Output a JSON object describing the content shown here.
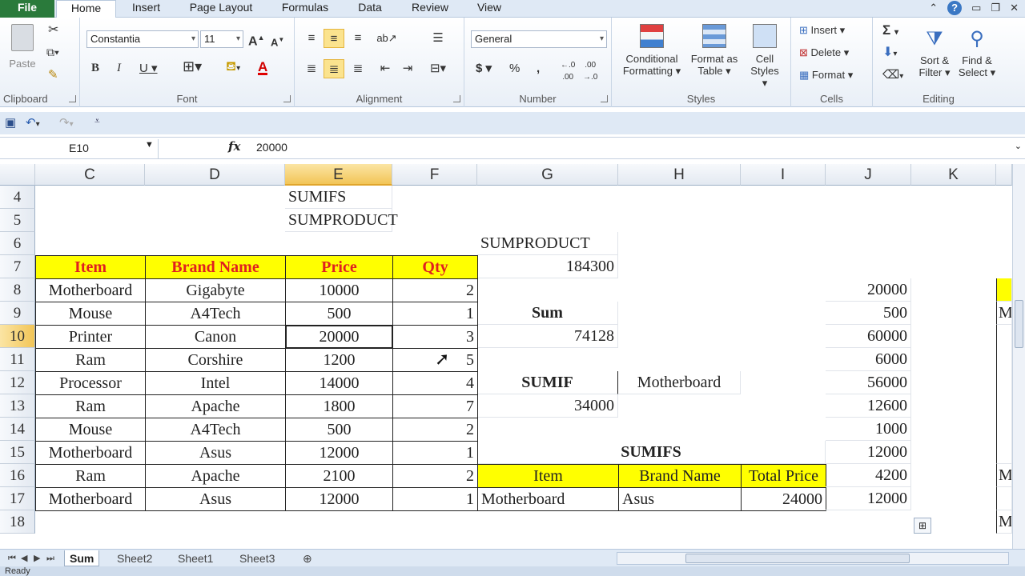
{
  "tabs": [
    "File",
    "Home",
    "Insert",
    "Page Layout",
    "Formulas",
    "Data",
    "Review",
    "View"
  ],
  "ribbon": {
    "clipboard": {
      "label": "Clipboard",
      "paste": "Paste"
    },
    "font": {
      "label": "Font",
      "family": "Constantia",
      "size": "11"
    },
    "alignment": {
      "label": "Alignment"
    },
    "number": {
      "label": "Number",
      "format": "General"
    },
    "styles": {
      "label": "Styles",
      "conditional": "Conditional Formatting ▾",
      "format_table": "Format as Table ▾",
      "cell_styles": "Cell Styles ▾"
    },
    "cells": {
      "label": "Cells",
      "insert": "Insert",
      "delete": "Delete",
      "format": "Format"
    },
    "editing": {
      "label": "Editing",
      "sort": "Sort & Filter ▾",
      "find": "Find & Select ▾"
    }
  },
  "formula_bar": {
    "name_box": "E10",
    "value": "20000"
  },
  "columns": [
    "C",
    "D",
    "E",
    "F",
    "G",
    "H",
    "I",
    "J",
    "K"
  ],
  "rows": [
    "4",
    "5",
    "6",
    "7",
    "8",
    "9",
    "10",
    "11",
    "12",
    "13",
    "14",
    "15",
    "16",
    "17",
    "18"
  ],
  "cells": {
    "e4": "SUMIFS",
    "e5": "SUMPRODUCT",
    "g6": "SUMPRODUCT",
    "g7": "184300",
    "g9": "Sum",
    "g10": "74128",
    "g12": "SUMIF",
    "h12": "Motherboard",
    "g13": "34000",
    "h15": "SUMIFS",
    "sumifs_headers": [
      "Item",
      "Brand Name",
      "Total Price"
    ],
    "sumifs_row": [
      "Motherboard",
      "Asus",
      "24000"
    ]
  },
  "table": {
    "headers": [
      "Item",
      "Brand Name",
      "Price",
      "Qty"
    ],
    "rows": [
      [
        "Motherboard",
        "Gigabyte",
        "10000",
        "2"
      ],
      [
        "Mouse",
        "A4Tech",
        "500",
        "1"
      ],
      [
        "Printer",
        "Canon",
        "20000",
        "3"
      ],
      [
        "Ram",
        "Corshire",
        "1200",
        "5"
      ],
      [
        "Processor",
        "Intel",
        "14000",
        "4"
      ],
      [
        "Ram",
        "Apache",
        "1800",
        "7"
      ],
      [
        "Mouse",
        "A4Tech",
        "500",
        "2"
      ],
      [
        "Motherboard",
        "Asus",
        "12000",
        "1"
      ],
      [
        "Ram",
        "Apache",
        "2100",
        "2"
      ],
      [
        "Motherboard",
        "Asus",
        "12000",
        "1"
      ]
    ]
  },
  "col_j": [
    "20000",
    "500",
    "60000",
    "6000",
    "56000",
    "12600",
    "1000",
    "12000",
    "4200",
    "12000"
  ],
  "col_l_partial": [
    "M",
    "M",
    "M"
  ],
  "sheets": [
    "Sum",
    "Sheet2",
    "Sheet1",
    "Sheet3"
  ],
  "status": "Ready"
}
